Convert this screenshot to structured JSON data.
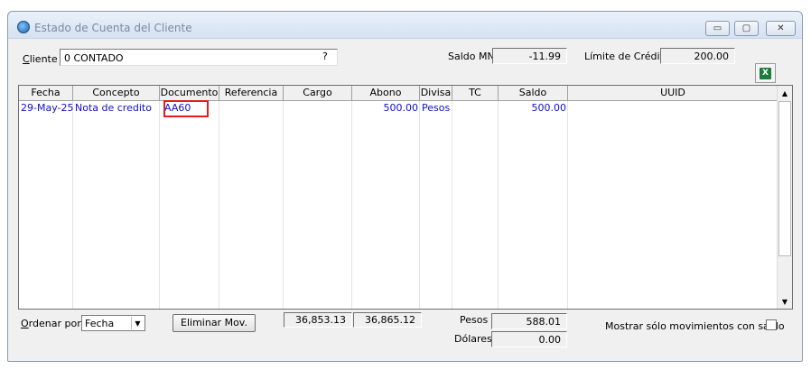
{
  "window": {
    "title": "Estado de Cuenta del Cliente"
  },
  "cliente": {
    "label_prefix": "C",
    "label_rest": "liente",
    "value": "0 CONTADO",
    "lookup": "?"
  },
  "saldo_mn": {
    "label": "Saldo MN",
    "value": "-11.99"
  },
  "limite_credito": {
    "label": "Límite de Crédito",
    "value": "200.00"
  },
  "excel_button": {
    "icon": "excel-icon",
    "glyph": "X"
  },
  "grid": {
    "columns": [
      "Fecha",
      "Concepto",
      "Documento",
      "Referencia",
      "Cargo",
      "Abono",
      "Divisa",
      "TC",
      "Saldo",
      "UUID"
    ],
    "rows": [
      {
        "fecha": "29-May-25",
        "concepto": "Nota de credito",
        "documento": "AA60",
        "referencia": "",
        "cargo": "",
        "abono": "500.00",
        "divisa": "Pesos",
        "tc": "",
        "saldo": "500.00",
        "uuid": ""
      }
    ],
    "row_text_color": "#1010c8",
    "highlight_color": "#e01e1e"
  },
  "ordenar": {
    "label_prefix": "O",
    "label_rest": "rdenar por",
    "selected": "Fecha"
  },
  "eliminar_button": {
    "label": "Eliminar Mov."
  },
  "totals": {
    "cargo": "36,853.13",
    "abono": "36,865.12"
  },
  "pesos": {
    "label": "Pesos",
    "value": "588.01"
  },
  "dolares": {
    "label": "Dólares",
    "value": "0.00"
  },
  "mostrar_saldo": {
    "label": "Mostrar sólo movimientos con saldo",
    "checked": false
  }
}
